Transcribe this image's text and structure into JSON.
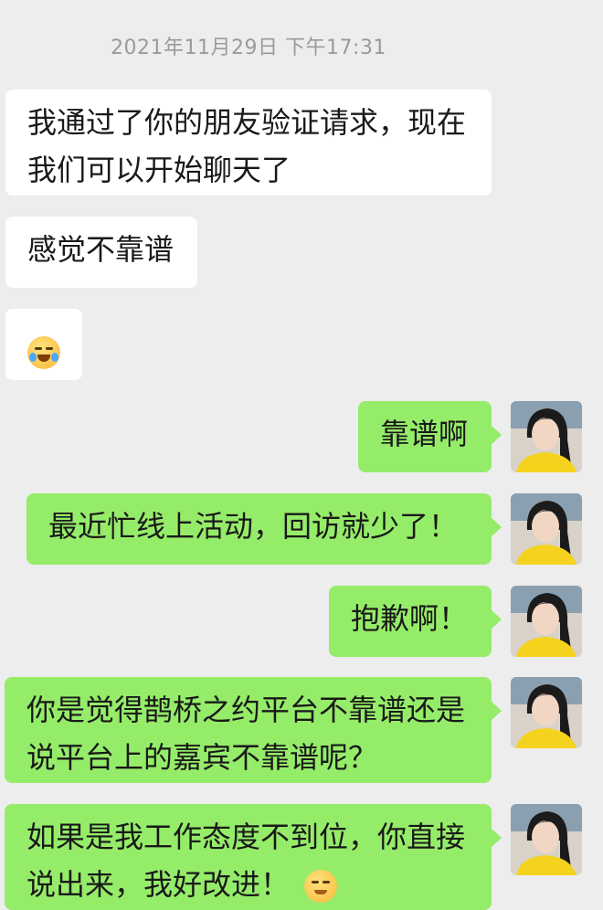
{
  "timestamp": "2021年11月29日 下午17:31",
  "messages": [
    {
      "side": "left",
      "lines": [
        "我通过了你的朋友验证请求，现在",
        "我们可以开始聊天了"
      ]
    },
    {
      "side": "left",
      "lines": [
        "感觉不靠谱"
      ]
    },
    {
      "side": "left",
      "emoji": "crying-laughing-emoji"
    },
    {
      "side": "right",
      "lines": [
        "靠谱啊"
      ]
    },
    {
      "side": "right",
      "lines": [
        "最近忙线上活动，回访就少了！"
      ]
    },
    {
      "side": "right",
      "lines": [
        "抱歉啊！"
      ]
    },
    {
      "side": "right",
      "lines": [
        "你是觉得鹊桥之约平台不靠谱还是",
        "说平台上的嘉宾不靠谱呢？"
      ]
    },
    {
      "side": "right",
      "lines": [
        "如果是我工作态度不到位，你直接",
        "说出来，我好改进！"
      ],
      "trailing_emoji": "slight-smile-emoji"
    }
  ],
  "avatar": {
    "name": "user-avatar",
    "shirt_color": "#f5d21e",
    "hair_color": "#1b1b1b"
  }
}
